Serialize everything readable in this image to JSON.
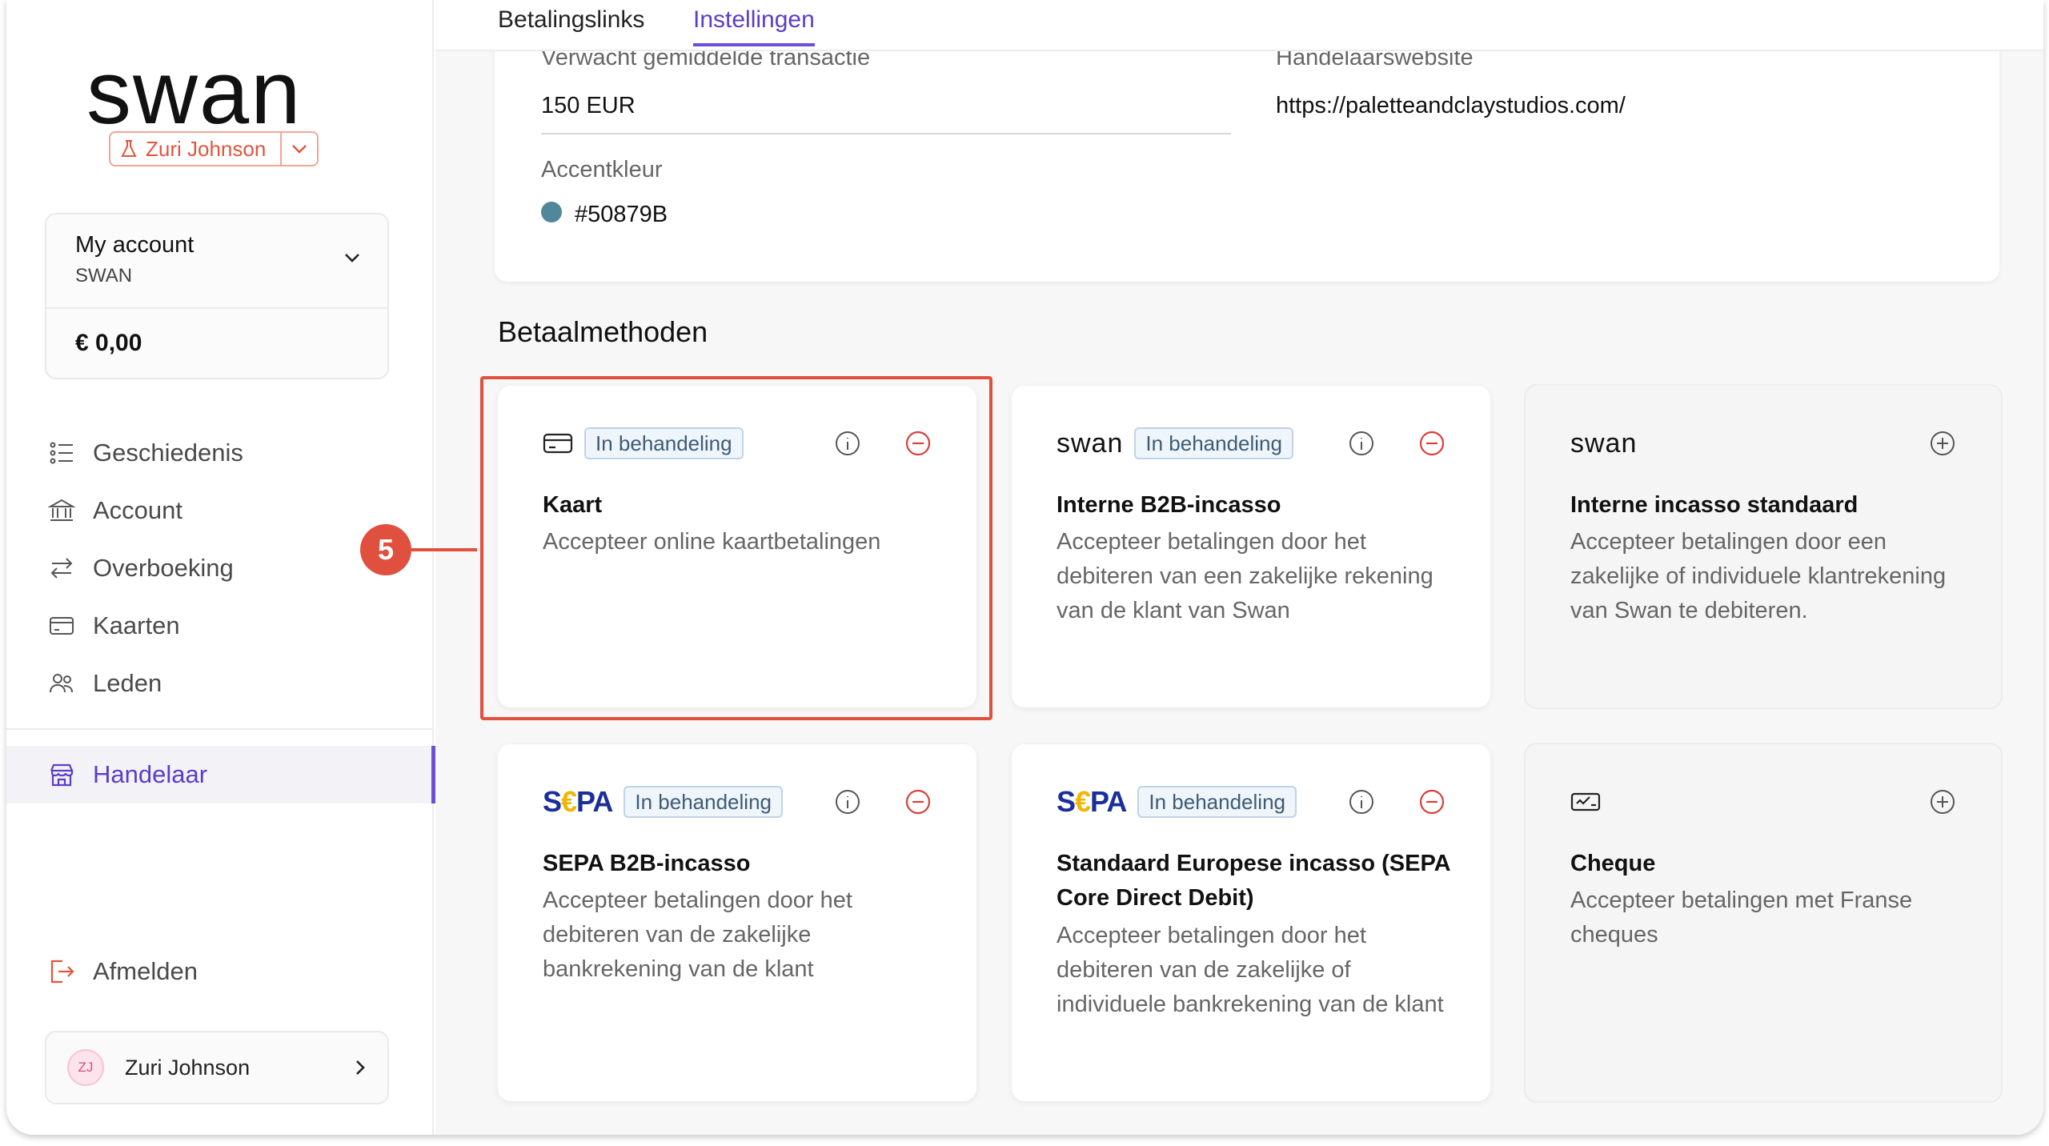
{
  "brand": {
    "logo_text": "swan",
    "sandbox_user": "Zuri Johnson"
  },
  "account": {
    "name": "My account",
    "sub": "SWAN",
    "balance": "€ 0,00"
  },
  "nav": {
    "items": [
      {
        "label": "Geschiedenis",
        "icon": "list-icon"
      },
      {
        "label": "Account",
        "icon": "bank-icon"
      },
      {
        "label": "Overboeking",
        "icon": "transfer-icon"
      },
      {
        "label": "Kaarten",
        "icon": "card-icon"
      },
      {
        "label": "Leden",
        "icon": "members-icon"
      }
    ],
    "active": {
      "label": "Handelaar",
      "icon": "shop-icon"
    },
    "logout": "Afmelden"
  },
  "user": {
    "initials": "ZJ",
    "name": "Zuri Johnson"
  },
  "tabs": [
    {
      "label": "Betalingslinks",
      "active": false
    },
    {
      "label": "Instellingen",
      "active": true
    }
  ],
  "settings": {
    "avg_label": "Verwacht gemiddelde transactie",
    "avg_value": "150 EUR",
    "website_label": "Handelaarswebsite",
    "website_value": "https://paletteandclaystudios.com/",
    "accent_label": "Accentkleur",
    "accent_value": "#50879B",
    "accent_color": "#50879B"
  },
  "payment_methods": {
    "section_title": "Betaalmethoden",
    "cards": [
      {
        "logo": "card-icon",
        "badge": "In behandeling",
        "title": "Kaart",
        "desc": "Accepteer online kaartbetalingen"
      },
      {
        "logo": "swan",
        "badge": "In behandeling",
        "title": "Interne B2B-incasso",
        "desc": "Accepteer betalingen door het debiteren van een zakelijke rekening van de klant van Swan"
      },
      {
        "logo": "swan",
        "badge": "",
        "title": "Interne incasso standaard",
        "desc": "Accepteer betalingen door een zakelijke of individuele klantrekening van Swan te debiteren."
      },
      {
        "logo_left": "S",
        "logo_mid": "€",
        "logo_right": "PA",
        "badge": "In behandeling",
        "title": "SEPA B2B-incasso",
        "desc": "Accepteer betalingen door het debiteren van de zakelijke bankrekening van de klant"
      },
      {
        "logo_left": "S",
        "logo_mid": "€",
        "logo_right": "PA",
        "badge": "In behandeling",
        "title": "Standaard Europese incasso (SEPA Core Direct Debit)",
        "desc": "Accepteer betalingen door het debiteren van de zakelijke of individuele bankrekening van de klant"
      },
      {
        "logo": "cheque-icon",
        "badge": "",
        "title": "Cheque",
        "desc": "Accepteer betalingen met Franse cheques"
      }
    ]
  },
  "annotation": {
    "step": "5",
    "color": "#E0503E"
  }
}
